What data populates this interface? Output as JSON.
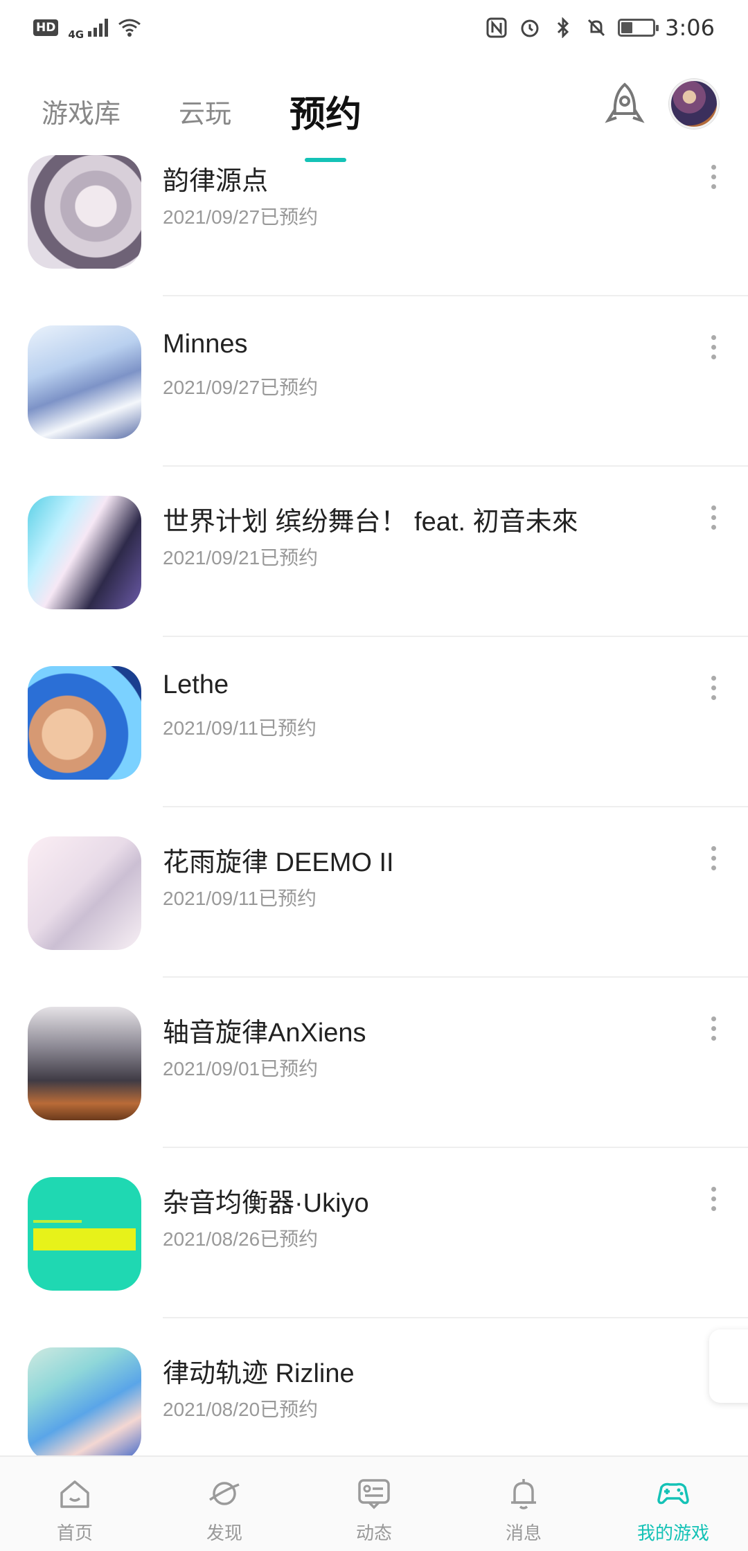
{
  "status_bar": {
    "hd": "HD",
    "network": "4G",
    "time": "3:06",
    "battery_percent": 35,
    "icons": [
      "signal-icon",
      "wifi-icon",
      "nfc-icon",
      "alarm-icon",
      "bluetooth-icon",
      "mute-icon",
      "battery-icon"
    ]
  },
  "top_tabs": {
    "tabs": [
      {
        "label": "游戏库",
        "active": false
      },
      {
        "label": "云玩",
        "active": false
      },
      {
        "label": "预约",
        "active": true
      }
    ],
    "accent_color": "#14c2b6",
    "right_icons": [
      "rocket-icon",
      "avatar"
    ]
  },
  "reservations": [
    {
      "title": "韵律源点",
      "subtitle": "2021/09/27已预约"
    },
    {
      "title": "Minnes",
      "subtitle": "2021/09/27已预约"
    },
    {
      "title": "世界计划 缤纷舞台！ feat. 初音未來",
      "subtitle": "2021/09/21已预约"
    },
    {
      "title": "Lethe",
      "subtitle": "2021/09/11已预约"
    },
    {
      "title": "花雨旋律 DEEMO II",
      "subtitle": "2021/09/11已预约"
    },
    {
      "title": "轴音旋律AnXiens",
      "subtitle": "2021/09/01已预约"
    },
    {
      "title": "杂音均衡器·Ukiyo",
      "subtitle": "2021/08/26已预约"
    },
    {
      "title": "律动轨迹 Rizline",
      "subtitle": "2021/08/20已预约"
    }
  ],
  "bottom_nav": {
    "items": [
      {
        "label": "首页",
        "icon": "home-icon",
        "active": false
      },
      {
        "label": "发现",
        "icon": "planet-icon",
        "active": false
      },
      {
        "label": "动态",
        "icon": "message-card-icon",
        "active": false
      },
      {
        "label": "消息",
        "icon": "bell-icon",
        "active": false
      },
      {
        "label": "我的游戏",
        "icon": "gamepad-icon",
        "active": true
      }
    ]
  }
}
